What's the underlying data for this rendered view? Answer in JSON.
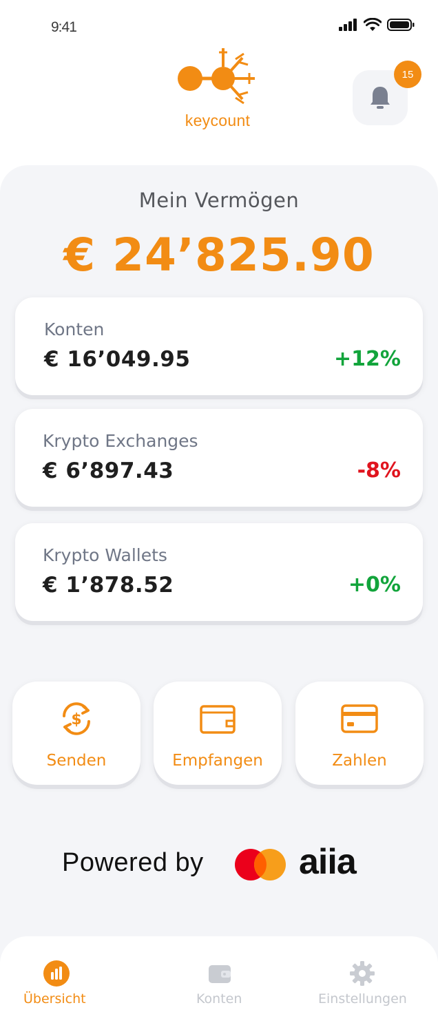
{
  "status_bar": {
    "time": "9:41"
  },
  "brand": {
    "name": "keycount"
  },
  "notifications": {
    "count": "15"
  },
  "overview": {
    "label": "Mein Vermögen",
    "total": "€ 24’825.90"
  },
  "accounts": [
    {
      "title": "Konten",
      "value": "€ 16’049.95",
      "change": "+12%",
      "change_color": "#12a43b"
    },
    {
      "title": "Krypto Exchanges",
      "value": "€ 6’897.43",
      "change": "-8%",
      "change_color": "#e0141e"
    },
    {
      "title": "Krypto Wallets",
      "value": "€ 1’878.52",
      "change": "+0%",
      "change_color": "#12a43b"
    }
  ],
  "actions": [
    {
      "label": "Senden",
      "icon": "currency-exchange-icon"
    },
    {
      "label": "Empfangen",
      "icon": "wallet-icon"
    },
    {
      "label": "Zahlen",
      "icon": "credit-card-icon"
    }
  ],
  "powered_by": {
    "text": "Powered by",
    "partner": "aiia",
    "partner_logo": "mastercard-logo"
  },
  "bottom_nav": [
    {
      "label": "Übersicht",
      "icon": "bar-chart-icon",
      "active": true
    },
    {
      "label": "Konten",
      "icon": "wallet-icon",
      "active": false
    },
    {
      "label": "Einstellungen",
      "icon": "gear-icon",
      "active": false
    }
  ],
  "colors": {
    "accent": "#f28c14",
    "positive": "#12a43b",
    "negative": "#e0141e",
    "inactive": "#c9ccd2"
  }
}
